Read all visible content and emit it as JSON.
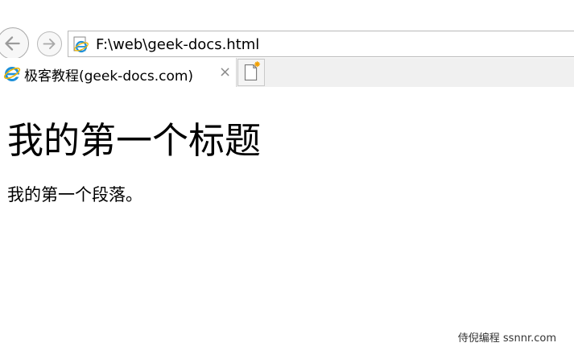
{
  "address_bar": {
    "url": "F:\\web\\geek-docs.html",
    "page_icon": "ie-page-icon"
  },
  "navigation": {
    "back_icon": "back-arrow-icon",
    "forward_icon": "forward-arrow-icon"
  },
  "tabs": [
    {
      "label": "极客教程(geek-docs.com)",
      "icon": "ie-logo-icon",
      "close_symbol": "×",
      "active": true
    }
  ],
  "new_tab_icon": "new-tab-icon",
  "page": {
    "heading": "我的第一个标题",
    "paragraph": "我的第一个段落。"
  },
  "watermark": "侍倪编程 ssnnr.com",
  "colors": {
    "ie_blue": "#1e90d8",
    "ie_gold": "#f2b705",
    "border": "#b8b8b8"
  }
}
